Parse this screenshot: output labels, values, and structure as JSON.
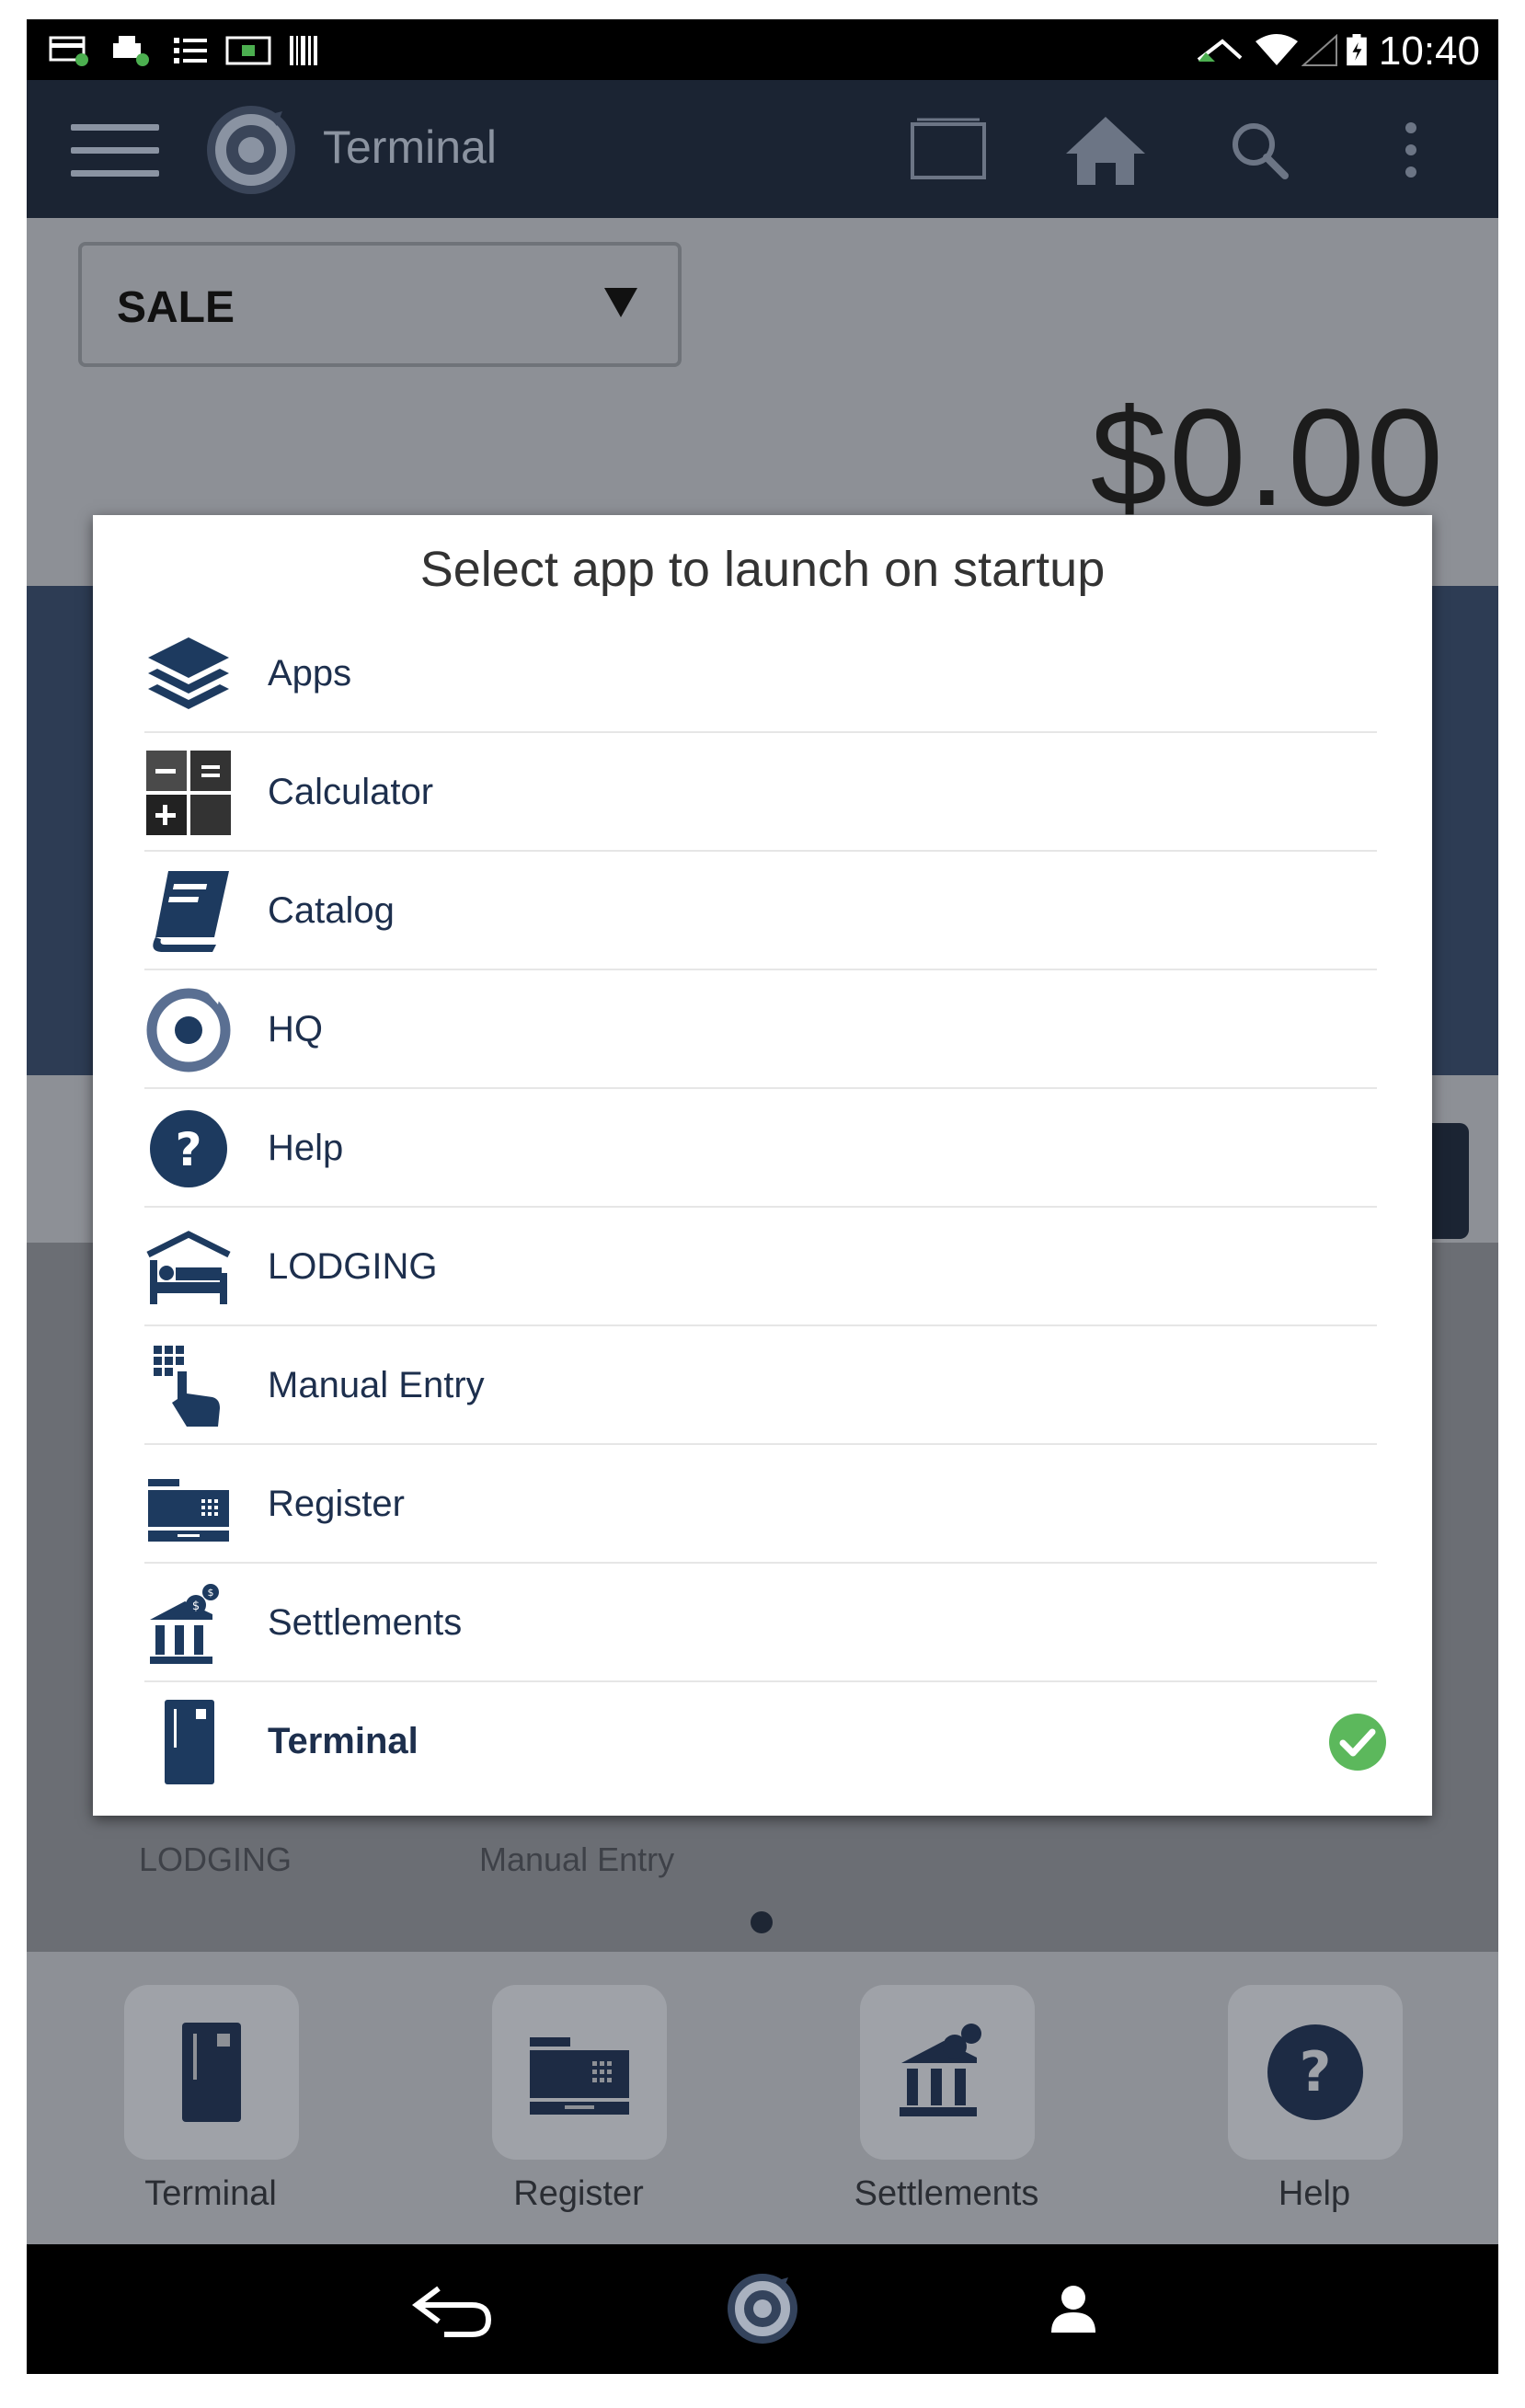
{
  "status_bar": {
    "time": "10:40",
    "left_icons": [
      "card-reader-icon",
      "printer-icon",
      "list-icon",
      "screen-icon",
      "barcode-icon"
    ],
    "right_icons": [
      "network-icon",
      "wifi-icon",
      "signal-icon",
      "battery-icon"
    ]
  },
  "app_bar": {
    "title": "Terminal",
    "icons": [
      "menu-icon",
      "logo-icon",
      "window-icon",
      "home-icon",
      "search-icon",
      "more-icon"
    ],
    "color": "#1b2433"
  },
  "terminal": {
    "transaction_type": "SALE",
    "amount": "$0.00"
  },
  "background_grid_labels": [
    "LODGING",
    "Manual Entry"
  ],
  "dialog": {
    "title": "Select app to launch on startup",
    "items": [
      {
        "label": "Apps",
        "icon": "layers-icon",
        "selected": false
      },
      {
        "label": "Calculator",
        "icon": "calculator-icon",
        "selected": false
      },
      {
        "label": "Catalog",
        "icon": "book-icon",
        "selected": false
      },
      {
        "label": "HQ",
        "icon": "hq-logo-icon",
        "selected": false
      },
      {
        "label": "Help",
        "icon": "help-icon",
        "selected": false
      },
      {
        "label": "LODGING",
        "icon": "bed-icon",
        "selected": false
      },
      {
        "label": "Manual Entry",
        "icon": "keypad-hand-icon",
        "selected": false
      },
      {
        "label": "Register",
        "icon": "cash-register-icon",
        "selected": false
      },
      {
        "label": "Settlements",
        "icon": "bank-icon",
        "selected": false
      },
      {
        "label": "Terminal",
        "icon": "terminal-icon",
        "selected": true
      }
    ],
    "check_color": "#5cb85c",
    "accent": "#1d3a5f"
  },
  "dock": {
    "items": [
      {
        "label": "Terminal",
        "icon": "terminal-icon"
      },
      {
        "label": "Register",
        "icon": "cash-register-icon"
      },
      {
        "label": "Settlements",
        "icon": "bank-icon"
      },
      {
        "label": "Help",
        "icon": "help-icon"
      }
    ]
  },
  "nav_bar": {
    "icons": [
      "back-icon",
      "home-logo-icon",
      "user-icon"
    ]
  }
}
